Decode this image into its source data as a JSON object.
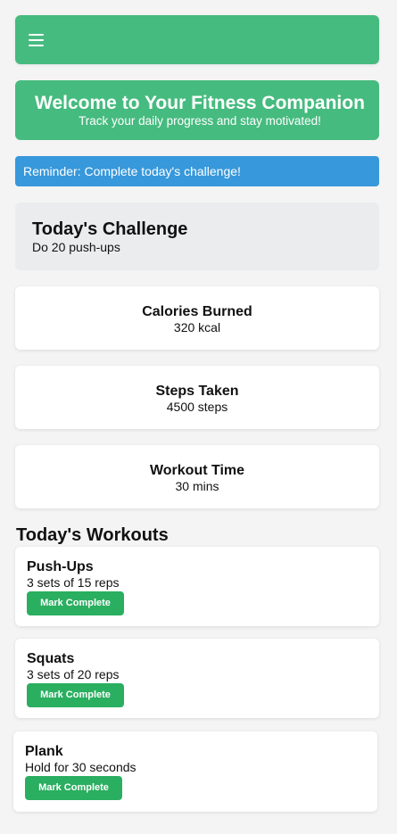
{
  "header": {
    "menu_icon": "hamburger-menu-icon",
    "brand_color": "#46bb7f"
  },
  "hero": {
    "title": "Welcome to Your Fitness Companion",
    "subtitle": "Track your daily progress and stay motivated!"
  },
  "reminder": {
    "text": "Reminder: Complete today's challenge!",
    "color": "#3798db"
  },
  "challenge": {
    "title": "Today's Challenge",
    "description": "Do 20 push-ups"
  },
  "stats": [
    {
      "title": "Calories Burned",
      "value": "320 kcal"
    },
    {
      "title": "Steps Taken",
      "value": "4500 steps"
    },
    {
      "title": "Workout Time",
      "value": "30 mins"
    }
  ],
  "workouts": {
    "section_title": "Today's Workouts",
    "button_color": "#2aae60",
    "items": [
      {
        "name": "Push-Ups",
        "detail": "3 sets of 15 reps",
        "button_label": "Mark Complete"
      },
      {
        "name": "Squats",
        "detail": "3 sets of 20 reps",
        "button_label": "Mark Complete"
      },
      {
        "name": "Plank",
        "detail": "Hold for 30 seconds",
        "button_label": "Mark Complete"
      }
    ]
  }
}
